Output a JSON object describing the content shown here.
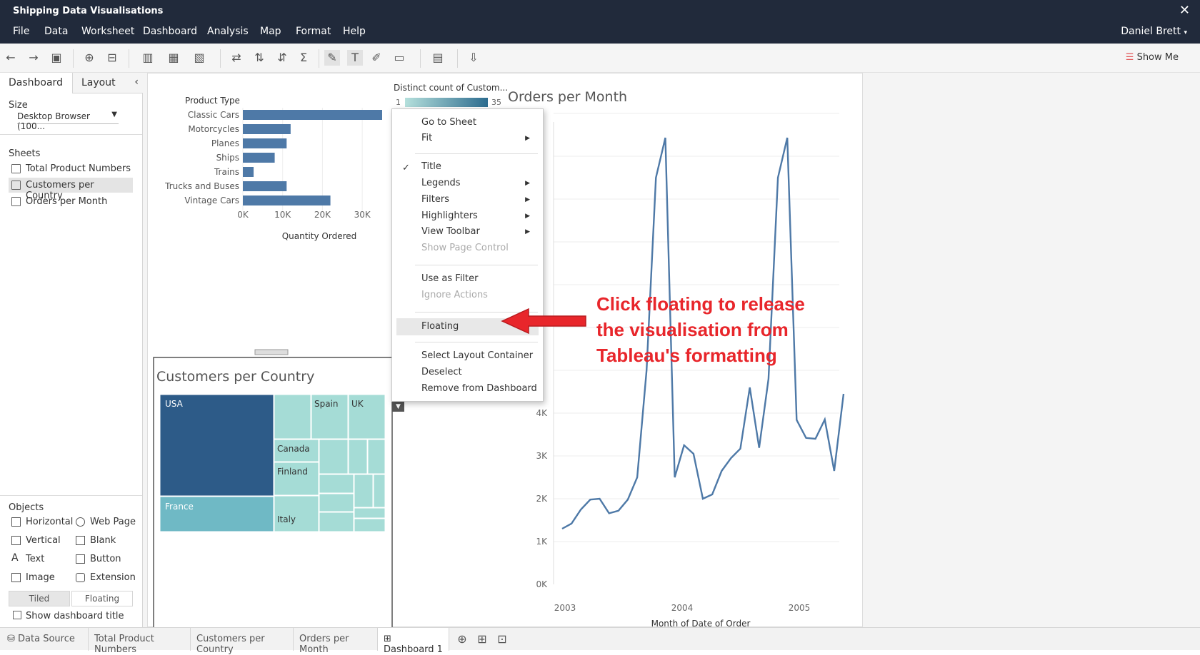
{
  "window": {
    "title": "Shipping Data Visualisations",
    "close": "✕"
  },
  "menu": [
    "File",
    "Data",
    "Worksheet",
    "Dashboard",
    "Analysis",
    "Map",
    "Format",
    "Help"
  ],
  "user": "Daniel Brett",
  "toolbar": {
    "show_me": "Show Me"
  },
  "left_panel": {
    "tabs": [
      "Dashboard",
      "Layout"
    ],
    "size_label": "Size",
    "size_value": "Desktop Browser (100...",
    "sheets_label": "Sheets",
    "sheets": [
      "Total Product Numbers",
      "Customers per Country",
      "Orders per Month"
    ],
    "selected_sheet": "Customers per Country",
    "objects_label": "Objects",
    "objects": [
      "Horizontal",
      "Web Page",
      "Vertical",
      "Blank",
      "Text",
      "Button",
      "Image",
      "Extension"
    ],
    "tiled": "Tiled",
    "floating": "Floating",
    "show_title": "Show dashboard title"
  },
  "context_menu": {
    "items": [
      "Go to Sheet",
      "Fit",
      "Title",
      "Legends",
      "Filters",
      "Highlighters",
      "View Toolbar",
      "Show Page Control",
      "Use as Filter",
      "Ignore Actions",
      "Floating",
      "Select Layout Container",
      "Deselect",
      "Remove from Dashboard"
    ]
  },
  "callout": [
    "Click floating to release",
    "the visualisation from",
    "Tableau's formatting"
  ],
  "bottom_tabs": [
    "Data Source",
    "Total Product Numbers",
    "Customers per Country",
    "Orders per Month",
    "Dashboard 1"
  ],
  "legend": {
    "title": "Distinct count of Custom...",
    "min": "1",
    "max": "35"
  },
  "chart_data": [
    {
      "type": "bar",
      "xlabel": "Quantity Ordered",
      "category_header": "Product Type",
      "categories": [
        "Classic Cars",
        "Motorcycles",
        "Planes",
        "Ships",
        "Trains",
        "Trucks and Buses",
        "Vintage Cars"
      ],
      "values": [
        35000,
        12000,
        11000,
        8000,
        2700,
        11000,
        22000
      ],
      "xticks": [
        "0K",
        "10K",
        "20K",
        "30K"
      ],
      "xlim": [
        0,
        38000
      ],
      "color": "#4e79a7"
    },
    {
      "type": "treemap",
      "title": "Customers per Country",
      "labels": [
        "USA",
        "Spain",
        "UK",
        "Canada",
        "Finland",
        "France",
        "Italy"
      ],
      "colors": {
        "dark": "#2d5b88",
        "mid": "#6fb9c5",
        "light": "#a5dcd6"
      }
    },
    {
      "type": "line",
      "title": "Orders per Month",
      "xlabel": "Month of Date of Order",
      "xticks": [
        "2003",
        "2004",
        "2005"
      ],
      "yticks": [
        "0K",
        "1K",
        "2K",
        "3K",
        "4K"
      ],
      "values": [
        1300,
        1420,
        1750,
        1980,
        2000,
        1660,
        1720,
        1980,
        2500,
        5000,
        9500,
        12000,
        2500,
        3250,
        3050,
        2000,
        2100,
        2650,
        2950,
        3170,
        4600,
        3190,
        4800,
        9500,
        12500,
        3840,
        3420,
        3400,
        3850,
        2650,
        4450
      ],
      "ylim": [
        0,
        14000
      ],
      "color": "#4e79a7"
    }
  ]
}
